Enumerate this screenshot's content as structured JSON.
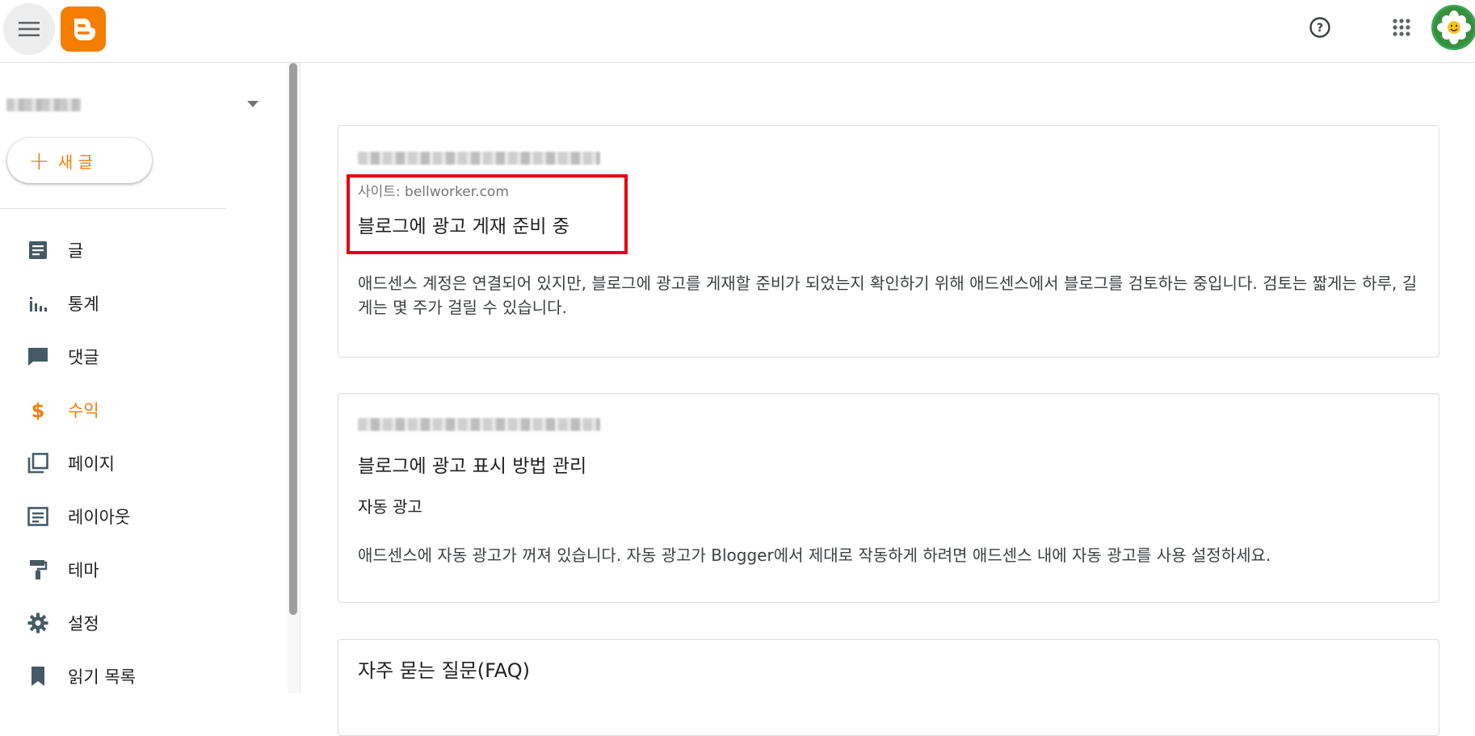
{
  "header": {
    "menu_icon": "hamburger-icon",
    "logo_icon": "blogger-logo",
    "help_icon": "help-icon",
    "apps_icon": "apps-grid-icon",
    "avatar_icon": "user-avatar"
  },
  "sidebar": {
    "new_post_label": "새 글",
    "items": [
      {
        "label": "글",
        "icon": "posts-icon"
      },
      {
        "label": "통계",
        "icon": "stats-icon"
      },
      {
        "label": "댓글",
        "icon": "comments-icon"
      },
      {
        "label": "수익",
        "icon": "earnings-icon"
      },
      {
        "label": "페이지",
        "icon": "pages-icon"
      },
      {
        "label": "레이아웃",
        "icon": "layout-icon"
      },
      {
        "label": "테마",
        "icon": "theme-icon"
      },
      {
        "label": "설정",
        "icon": "settings-icon"
      },
      {
        "label": "읽기 목록",
        "icon": "reading-list-icon"
      }
    ]
  },
  "main": {
    "card1": {
      "site_label": "사이트: bellworker.com",
      "title": "블로그에 광고 게재 준비 중",
      "body": "애드센스 계정은 연결되어 있지만, 블로그에 광고를 게재할 준비가 되었는지 확인하기 위해 애드센스에서 블로그를 검토하는 중입니다. 검토는 짧게는 하루, 길게는 몇 주가 걸릴 수 있습니다."
    },
    "card2": {
      "title": "블로그에 광고 표시 방법 관리",
      "subtitle": "자동 광고",
      "body": "애드센스에 자동 광고가 꺼져 있습니다. 자동 광고가 Blogger에서 제대로 작동하게 하려면 애드센스 내에 자동 광고를 사용 설정하세요."
    },
    "card3": {
      "title": "자주 묻는 질문(FAQ)"
    }
  },
  "colors": {
    "accent": "#f57d00",
    "highlight": "#e3000f"
  }
}
